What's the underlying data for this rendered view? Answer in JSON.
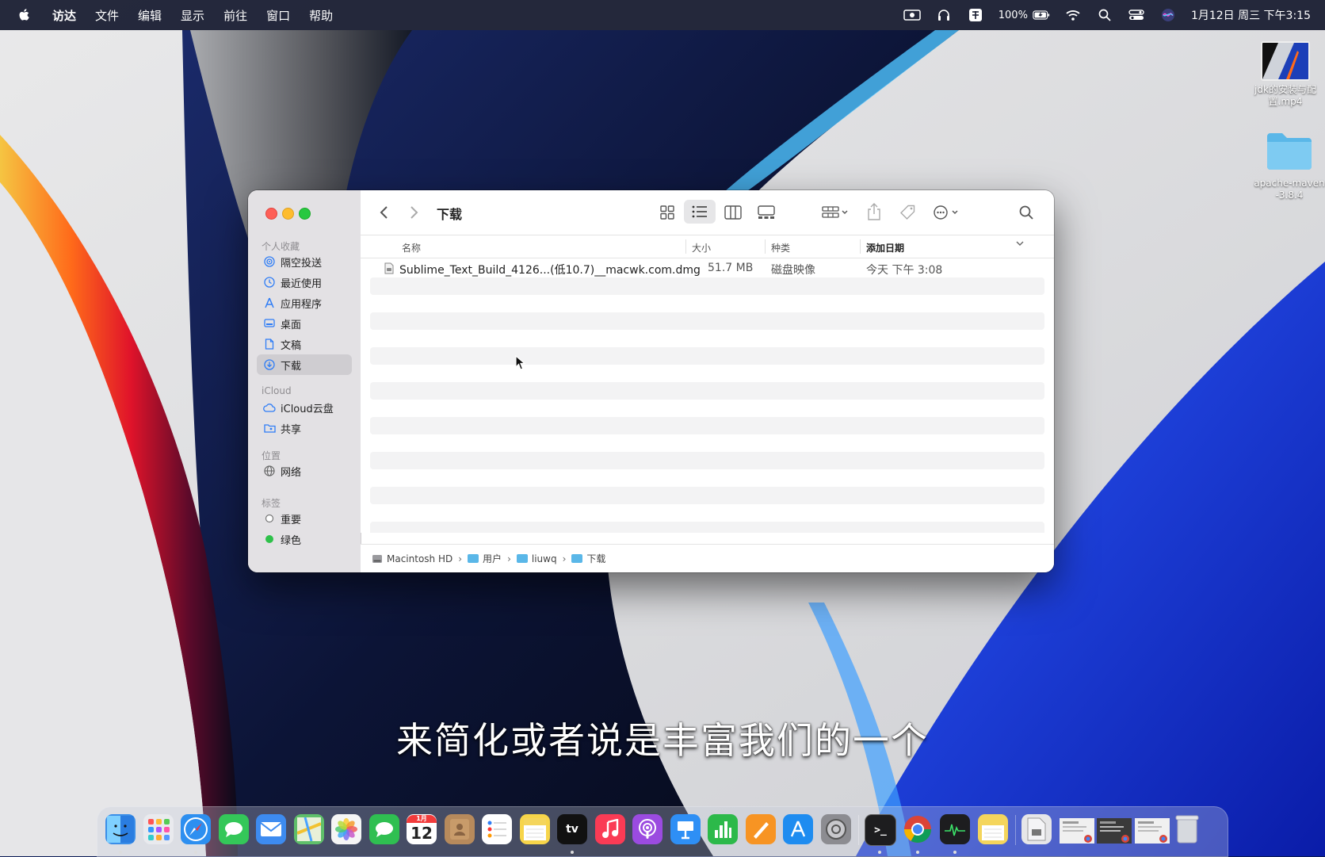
{
  "menubar": {
    "items": [
      "访达",
      "文件",
      "编辑",
      "显示",
      "前往",
      "窗口",
      "帮助"
    ],
    "battery": "100%",
    "clock": "1月12日 周三 下午3:15"
  },
  "desktop": {
    "items": [
      {
        "label": "jdk的安装与配置.mp4",
        "icon": "video-file-icon"
      },
      {
        "label": "apache-maven-3.8.4",
        "icon": "folder-icon"
      }
    ]
  },
  "finder": {
    "title": "下载",
    "sidebar": {
      "favorites_header": "个人收藏",
      "favorites": [
        {
          "label": "隔空投送",
          "icon": "airdrop-icon"
        },
        {
          "label": "最近使用",
          "icon": "clock-icon"
        },
        {
          "label": "应用程序",
          "icon": "applications-icon"
        },
        {
          "label": "桌面",
          "icon": "desktop-icon"
        },
        {
          "label": "文稿",
          "icon": "document-icon"
        },
        {
          "label": "下载",
          "icon": "download-icon"
        }
      ],
      "icloud_header": "iCloud",
      "icloud": [
        {
          "label": "iCloud云盘",
          "icon": "cloud-icon"
        },
        {
          "label": "共享",
          "icon": "shared-folder-icon"
        }
      ],
      "locations_header": "位置",
      "locations": [
        {
          "label": "网络",
          "icon": "network-globe-icon"
        }
      ],
      "tags_header": "标签",
      "tags": [
        {
          "label": "重要",
          "color": "#ffffff"
        },
        {
          "label": "绿色",
          "color": "#2ec14a"
        }
      ]
    },
    "columns": {
      "name": "名称",
      "size": "大小",
      "kind": "种类",
      "date_added": "添加日期"
    },
    "files": [
      {
        "name": "Sublime_Text_Build_4126...(低10.7)__macwk.com.dmg",
        "size": "51.7 MB",
        "kind": "磁盘映像",
        "date_added": "今天 下午 3:08"
      }
    ],
    "path": [
      "Macintosh HD",
      "用户",
      "liuwq",
      "下载"
    ]
  },
  "subtitle": "来简化或者说是丰富我们的一个",
  "dock": {
    "apps": [
      {
        "name": "finder-icon",
        "color": "#3a8ee8"
      },
      {
        "name": "launchpad-icon",
        "color": "#e9eaee"
      },
      {
        "name": "safari-icon",
        "color": "#2d8ff0"
      },
      {
        "name": "messages-icon",
        "color": "#34c759"
      },
      {
        "name": "mail-icon",
        "color": "#3d8bf0"
      },
      {
        "name": "maps-icon",
        "color": "#5fbf6a"
      },
      {
        "name": "photos-icon",
        "color": "#f5f5f5"
      },
      {
        "name": "facetime-icon",
        "color": "#2fbf51"
      },
      {
        "name": "calendar-icon",
        "color": "#ffffff"
      },
      {
        "name": "contacts-icon",
        "color": "#b78a5c"
      },
      {
        "name": "reminders-icon",
        "color": "#ffffff"
      },
      {
        "name": "notes-icon",
        "color": "#f7d54a"
      },
      {
        "name": "tv-icon",
        "color": "#111111"
      },
      {
        "name": "music-icon",
        "color": "#fa3b55"
      },
      {
        "name": "podcasts-icon",
        "color": "#9b4be0"
      },
      {
        "name": "keynote-icon",
        "color": "#2e8ff5"
      },
      {
        "name": "numbers-icon",
        "color": "#2cb94a"
      },
      {
        "name": "pages-icon",
        "color": "#f79423"
      },
      {
        "name": "app-store-icon",
        "color": "#1e8cf0"
      },
      {
        "name": "system-preferences-icon",
        "color": "#8c8c91"
      },
      {
        "name": "terminal-icon",
        "color": "#1d1d1f"
      },
      {
        "name": "chrome-icon",
        "color": "#ffffff"
      },
      {
        "name": "activity-monitor-icon",
        "color": "#1d1d1f"
      },
      {
        "name": "notes-folder-icon",
        "color": "#f4d55c"
      },
      {
        "name": "document-stack-icon",
        "color": "#e6e6e8"
      },
      {
        "name": "window-thumbnail-1-icon",
        "color": "#f0f0f0"
      },
      {
        "name": "window-thumbnail-2-icon",
        "color": "#3a3a3a"
      },
      {
        "name": "window-thumbnail-3-icon",
        "color": "#f0f0f0"
      },
      {
        "name": "trash-icon",
        "color": "#cfd3d8"
      }
    ],
    "calendar_day": "12",
    "calendar_month": "1月",
    "tv_label": "tv"
  },
  "accent_color": "#2f7df6"
}
